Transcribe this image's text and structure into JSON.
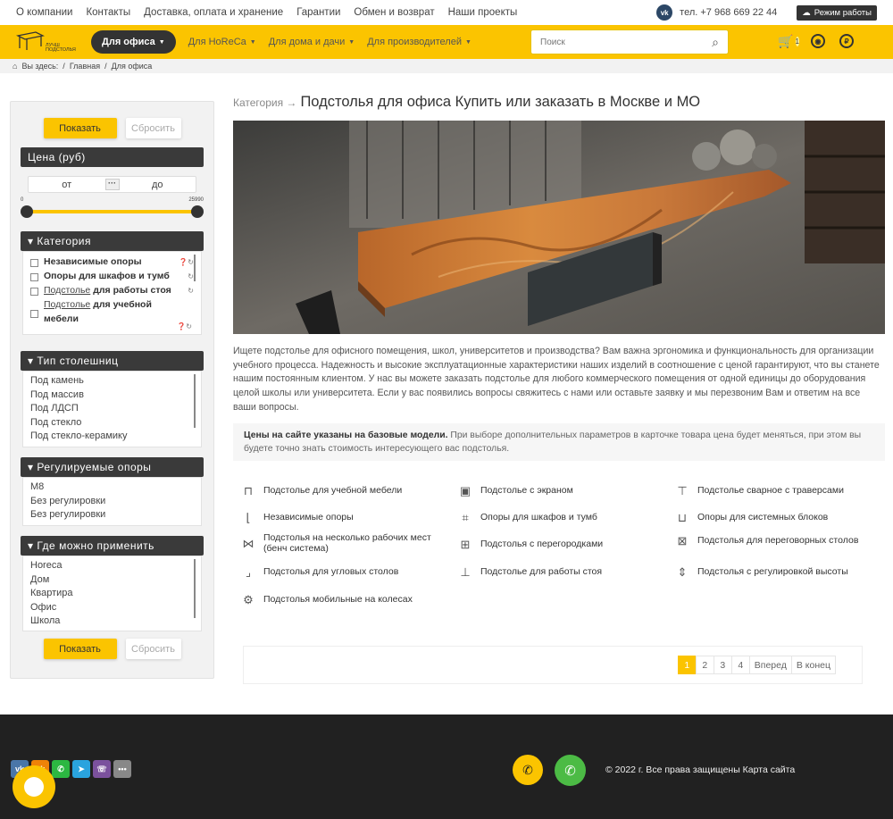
{
  "topbar": {
    "links": [
      "О компании",
      "Контакты",
      "Доставка, оплата и хранение",
      "Гарантии",
      "Обмен и возврат",
      "Наши проекты"
    ],
    "phone": "тел. +7 968 669 22 44",
    "mode_label": "Режим работы"
  },
  "nav": {
    "logo_text": "ЛУЧШ ПОДСТОЛЬЯ",
    "items": [
      "Для офиса",
      "Для HoReCa",
      "Для дома и дачи",
      "Для производителей"
    ],
    "search_placeholder": "Поиск",
    "cart_count": "1"
  },
  "breadcrumb": {
    "label": "Вы здесь:",
    "items": [
      "Главная",
      "Для офиса"
    ]
  },
  "sidebar": {
    "show_label": "Показать",
    "reset_label": "Сбросить",
    "price": {
      "title": "Цена (руб)",
      "from": "от",
      "to": "до",
      "min": "0",
      "max": "25990"
    },
    "category": {
      "title": "Категория",
      "items": [
        {
          "bold": "Независимые опоры",
          "plain": ""
        },
        {
          "bold": "Опоры для шкафов и тумб",
          "plain": ""
        },
        {
          "under": "Подстолье",
          "bold": " для работы стоя"
        },
        {
          "under": "Подстолье",
          "bold": " для учебной мебели"
        }
      ]
    },
    "tabletop": {
      "title": "Тип столешниц",
      "items": [
        "Под камень",
        "Под массив",
        "Под ЛДСП",
        "Под стекло",
        "Под стекло-керамику"
      ]
    },
    "supports": {
      "title": "Регулируемые опоры",
      "items": [
        "M8",
        "Без регулировки",
        "Без регулировки"
      ]
    },
    "where": {
      "title": "Где можно применить",
      "items": [
        "Horeca",
        "Дом",
        "Квартира",
        "Офис",
        "Школа"
      ]
    }
  },
  "main": {
    "category_label": "Категория →",
    "title": "Подстолья для офиса Купить или заказать в Москве и МО",
    "description": "Ищете подстолье для офисного помещения, школ, университетов и производства? Вам важна эргономика и функциональность для организации учебного процесса. Надежность и высокие эксплуатационные характеристики наших изделий в соотношение с ценой гарантируют, что вы станете нашим постоянным клиентом. У нас вы можете заказать подстолье для любого коммерческого помещения от одной единицы до оборудования целой школы или университета. Если у вас появились вопросы свяжитесь с нами или оставьте заявку и мы перезвоним Вам и ответим на все ваши вопросы.",
    "note_bold": "Цены на сайте указаны на базовые модели.",
    "note_rest": " При выборе дополнительных параметров в карточке товара цена будет меняться, при этом вы будете точно знать стоимость интересующего вас подстолья.",
    "subcategories": [
      {
        "label": "Подстолье для учебной мебели",
        "icon": "desk-icon"
      },
      {
        "label": "Подстолье с экраном",
        "icon": "screen-desk-icon"
      },
      {
        "label": "Подстолье сварное с траверсами",
        "icon": "welded-desk-icon"
      },
      {
        "label": "Независимые опоры",
        "icon": "leg-icon"
      },
      {
        "label": "Опоры для шкафов и тумб",
        "icon": "cabinet-leg-icon"
      },
      {
        "label": "Опоры для системных блоков",
        "icon": "pc-support-icon"
      },
      {
        "label": "Подстолья на несколько рабочих мест (бенч система)",
        "icon": "bench-icon"
      },
      {
        "label": "Подстолья с перегородками",
        "icon": "partition-icon"
      },
      {
        "label": "Подстолья для переговорных столов",
        "icon": "meeting-icon"
      },
      {
        "label": "Подстолья для угловых столов",
        "icon": "corner-icon"
      },
      {
        "label": "Подстолье для работы стоя",
        "icon": "standing-icon"
      },
      {
        "label": "Подстолья с регулировкой высоты",
        "icon": "height-adjust-icon"
      },
      {
        "label": "Подстолья мобильные на колесах",
        "icon": "wheels-icon"
      }
    ],
    "pagination": [
      "1",
      "2",
      "3",
      "4",
      "Вперед",
      "В конец"
    ]
  },
  "footer": {
    "copyright": "© 2022 г. Все права защищены Карта сайта",
    "social": [
      "vk",
      "ok",
      "whatsapp",
      "telegram",
      "viber",
      "more"
    ]
  },
  "colors": {
    "accent": "#fbc400",
    "dark": "#333333",
    "footer": "#212121",
    "whatsapp": "#4cbb45"
  }
}
